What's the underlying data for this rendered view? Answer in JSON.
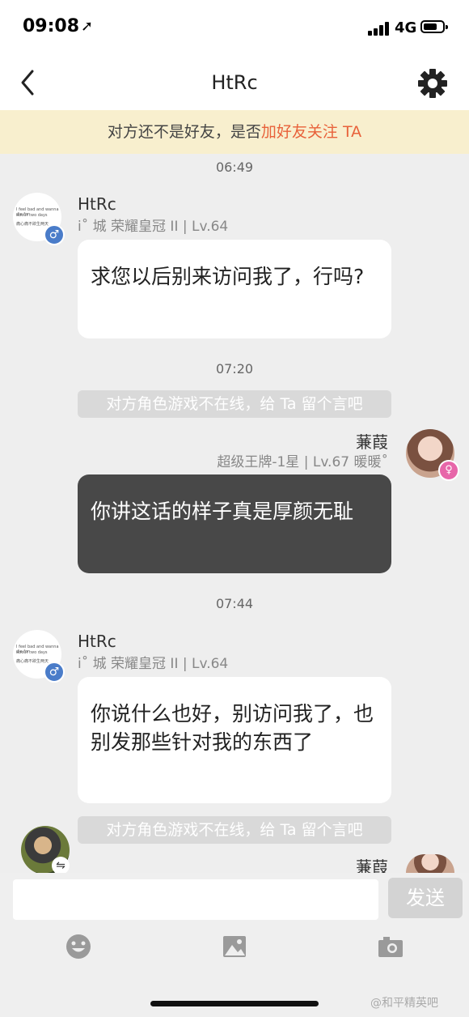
{
  "status_bar": {
    "time": "09:08",
    "network": "4G"
  },
  "header": {
    "title": "HtRc"
  },
  "banner": {
    "text": "对方还不是好友，是否",
    "action": "加好友关注 TA"
  },
  "messages": [
    {
      "type": "timestamp",
      "text": "06:49"
    },
    {
      "type": "incoming",
      "name": "HtRc",
      "meta": "i˚ 城 荣耀皇冠 II | Lv.64",
      "text": "求您以后别来访问我了，行吗?"
    },
    {
      "type": "timestamp",
      "text": "07:20"
    },
    {
      "type": "notice",
      "text": "对方角色游戏不在线，给 Ta 留个言吧"
    },
    {
      "type": "outgoing",
      "name": "蒹葭",
      "meta": "超级王牌-1星 | Lv.67 暖暖˚",
      "text": "你讲这话的样子真是厚颜无耻"
    },
    {
      "type": "timestamp",
      "text": "07:44"
    },
    {
      "type": "incoming",
      "name": "HtRc",
      "meta": "i˚ 城 荣耀皇冠 II | Lv.64",
      "text": "你说什么也好，别访问我了，也别发那些针对我的东西了"
    },
    {
      "type": "notice",
      "text": "对方角色游戏不在线，给 Ta 留个言吧"
    },
    {
      "type": "outgoing",
      "name": "蒹葭"
    }
  ],
  "avatar_left_text": {
    "line1": "I feel bad and wanna die for",
    "line2": "about two days",
    "line3": "痛心痛不欲生两天"
  },
  "input": {
    "placeholder": "",
    "send_label": "发送"
  },
  "toolbar": [
    "emoji-icon",
    "image-icon",
    "camera-icon"
  ],
  "watermark": "@和平精英吧",
  "colors": {
    "banner_bg": "#f8efce",
    "accent": "#e8613a",
    "dark_bubble": "#484848",
    "male": "#4a7cc9",
    "female": "#e766a9"
  }
}
